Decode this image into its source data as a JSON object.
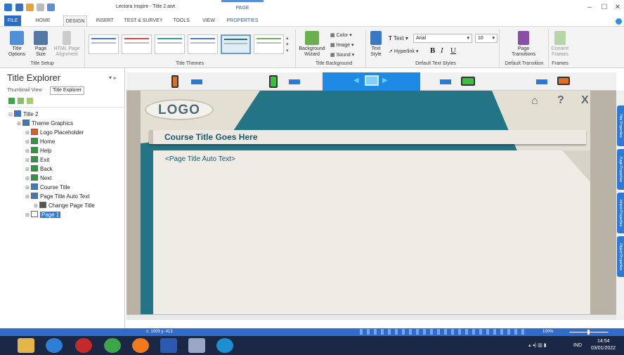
{
  "window": {
    "title": "Lectora Inspire - Title 2.awt",
    "context_header": "PAGE"
  },
  "tabs": [
    "FILE",
    "HOME",
    "DESIGN",
    "INSERT",
    "TEST & SURVEY",
    "TOOLS",
    "VIEW",
    "PROPERTIES"
  ],
  "active_tab": "DESIGN",
  "ribbon": {
    "title_setup": {
      "options": "Title Options",
      "page_size": "Page Size",
      "html_page_alignment": "HTML Page Alignment",
      "group": "Title Setup"
    },
    "title_themes": {
      "group": "Title Themes"
    },
    "title_background": {
      "wizard": "Background Wizard",
      "color": "Color",
      "image": "Image",
      "sound": "Sound",
      "group": "Title Background"
    },
    "text_styles": {
      "text_style": "Text Style",
      "text": "Text",
      "font": "Arial",
      "size": "10",
      "hyperlink": "Hyperlink",
      "bold": "B",
      "italic": "I",
      "underline": "U",
      "group": "Default Text Styles"
    },
    "transitions": {
      "page_transitions": "Page Transitions",
      "group": "Default Transition"
    },
    "frames": {
      "content_frames": "Content Frames",
      "group": "Frames"
    }
  },
  "explorer": {
    "title": "Title Explorer",
    "views": [
      "Thumbnail View",
      "Title Explorer"
    ],
    "tree": [
      {
        "label": "Title 2",
        "level": 0,
        "color": "#3a78c8"
      },
      {
        "label": "Theme Graphics",
        "level": 1,
        "color": "#3a78c8"
      },
      {
        "label": "Logo Placeholder",
        "level": 2,
        "color": "#e05a2a"
      },
      {
        "label": "Home",
        "level": 2,
        "color": "#2e9a3e"
      },
      {
        "label": "Help",
        "level": 2,
        "color": "#2e9a3e"
      },
      {
        "label": "Exit",
        "level": 2,
        "color": "#2e9a3e"
      },
      {
        "label": "Back",
        "level": 2,
        "color": "#2e9a3e"
      },
      {
        "label": "Next",
        "level": 2,
        "color": "#2e9a3e"
      },
      {
        "label": "Course Title",
        "level": 2,
        "color": "#3a78c8"
      },
      {
        "label": "Page Title Auto Text",
        "level": 2,
        "color": "#3a78c8"
      },
      {
        "label": "Change Page Title",
        "level": 3,
        "color": "#555555"
      },
      {
        "label": "Page 1",
        "level": 2,
        "color": "#ffffff",
        "selected": true
      }
    ]
  },
  "page": {
    "logo": "LOGO",
    "course_title": "Course Title Goes Here",
    "page_title": "<Page Title Auto Text>",
    "home_icon": "home-icon",
    "help": "?",
    "exit": "X"
  },
  "side_tabs": [
    "Title Properties",
    "Page Properties",
    "Inherit Properties",
    "Object Properties"
  ],
  "status": {
    "coords": "x: 1009  y: 413",
    "zoom": "100%"
  },
  "taskbar": {
    "time": "14:54",
    "date": "03/01/2022",
    "lang": "IND"
  },
  "colors": {
    "accent": "#2f6ccb",
    "teal": "#1f6f7e",
    "title_text": "#17596a"
  }
}
